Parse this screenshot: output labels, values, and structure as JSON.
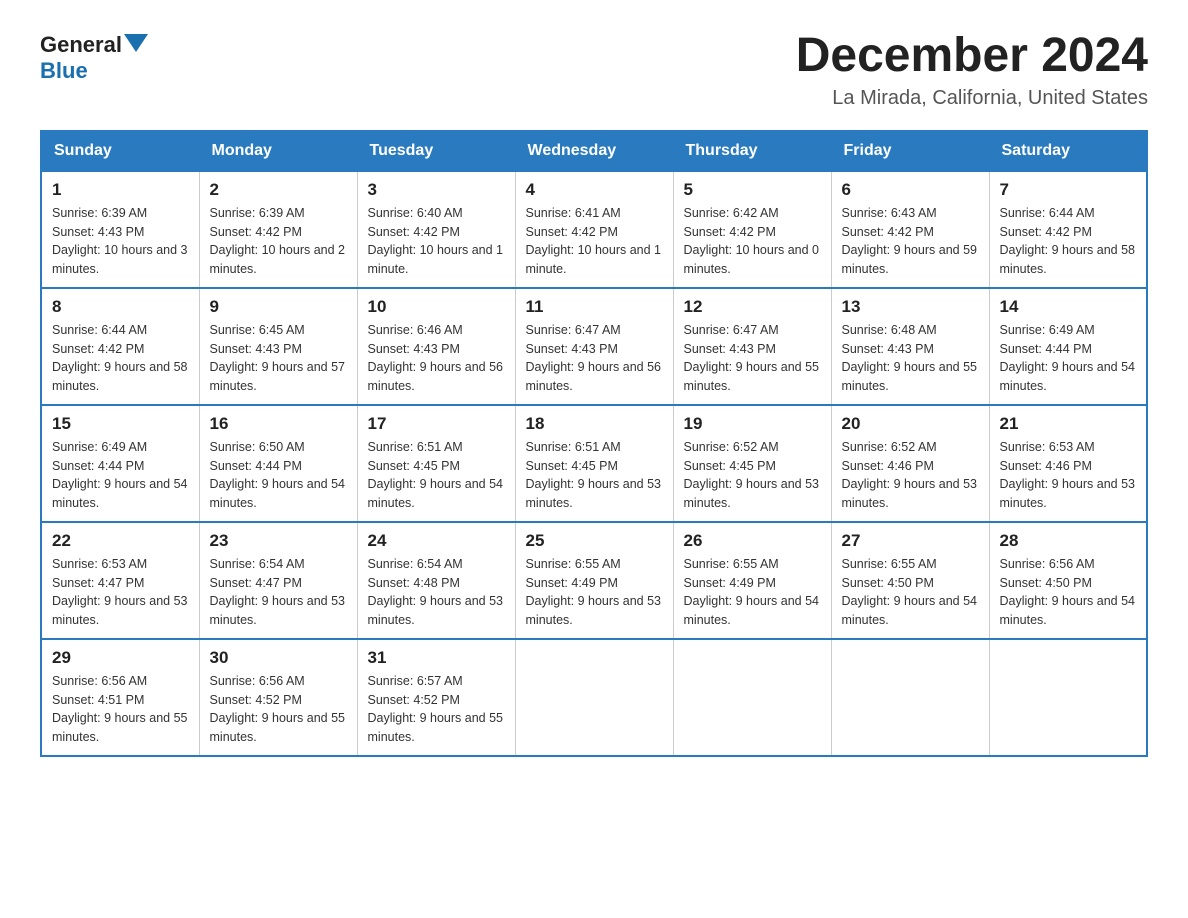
{
  "logo": {
    "general": "General",
    "blue": "Blue"
  },
  "header": {
    "month": "December 2024",
    "location": "La Mirada, California, United States"
  },
  "days_of_week": [
    "Sunday",
    "Monday",
    "Tuesday",
    "Wednesday",
    "Thursday",
    "Friday",
    "Saturday"
  ],
  "weeks": [
    [
      {
        "day": "1",
        "sunrise": "6:39 AM",
        "sunset": "4:43 PM",
        "daylight": "10 hours and 3 minutes."
      },
      {
        "day": "2",
        "sunrise": "6:39 AM",
        "sunset": "4:42 PM",
        "daylight": "10 hours and 2 minutes."
      },
      {
        "day": "3",
        "sunrise": "6:40 AM",
        "sunset": "4:42 PM",
        "daylight": "10 hours and 1 minute."
      },
      {
        "day": "4",
        "sunrise": "6:41 AM",
        "sunset": "4:42 PM",
        "daylight": "10 hours and 1 minute."
      },
      {
        "day": "5",
        "sunrise": "6:42 AM",
        "sunset": "4:42 PM",
        "daylight": "10 hours and 0 minutes."
      },
      {
        "day": "6",
        "sunrise": "6:43 AM",
        "sunset": "4:42 PM",
        "daylight": "9 hours and 59 minutes."
      },
      {
        "day": "7",
        "sunrise": "6:44 AM",
        "sunset": "4:42 PM",
        "daylight": "9 hours and 58 minutes."
      }
    ],
    [
      {
        "day": "8",
        "sunrise": "6:44 AM",
        "sunset": "4:42 PM",
        "daylight": "9 hours and 58 minutes."
      },
      {
        "day": "9",
        "sunrise": "6:45 AM",
        "sunset": "4:43 PM",
        "daylight": "9 hours and 57 minutes."
      },
      {
        "day": "10",
        "sunrise": "6:46 AM",
        "sunset": "4:43 PM",
        "daylight": "9 hours and 56 minutes."
      },
      {
        "day": "11",
        "sunrise": "6:47 AM",
        "sunset": "4:43 PM",
        "daylight": "9 hours and 56 minutes."
      },
      {
        "day": "12",
        "sunrise": "6:47 AM",
        "sunset": "4:43 PM",
        "daylight": "9 hours and 55 minutes."
      },
      {
        "day": "13",
        "sunrise": "6:48 AM",
        "sunset": "4:43 PM",
        "daylight": "9 hours and 55 minutes."
      },
      {
        "day": "14",
        "sunrise": "6:49 AM",
        "sunset": "4:44 PM",
        "daylight": "9 hours and 54 minutes."
      }
    ],
    [
      {
        "day": "15",
        "sunrise": "6:49 AM",
        "sunset": "4:44 PM",
        "daylight": "9 hours and 54 minutes."
      },
      {
        "day": "16",
        "sunrise": "6:50 AM",
        "sunset": "4:44 PM",
        "daylight": "9 hours and 54 minutes."
      },
      {
        "day": "17",
        "sunrise": "6:51 AM",
        "sunset": "4:45 PM",
        "daylight": "9 hours and 54 minutes."
      },
      {
        "day": "18",
        "sunrise": "6:51 AM",
        "sunset": "4:45 PM",
        "daylight": "9 hours and 53 minutes."
      },
      {
        "day": "19",
        "sunrise": "6:52 AM",
        "sunset": "4:45 PM",
        "daylight": "9 hours and 53 minutes."
      },
      {
        "day": "20",
        "sunrise": "6:52 AM",
        "sunset": "4:46 PM",
        "daylight": "9 hours and 53 minutes."
      },
      {
        "day": "21",
        "sunrise": "6:53 AM",
        "sunset": "4:46 PM",
        "daylight": "9 hours and 53 minutes."
      }
    ],
    [
      {
        "day": "22",
        "sunrise": "6:53 AM",
        "sunset": "4:47 PM",
        "daylight": "9 hours and 53 minutes."
      },
      {
        "day": "23",
        "sunrise": "6:54 AM",
        "sunset": "4:47 PM",
        "daylight": "9 hours and 53 minutes."
      },
      {
        "day": "24",
        "sunrise": "6:54 AM",
        "sunset": "4:48 PM",
        "daylight": "9 hours and 53 minutes."
      },
      {
        "day": "25",
        "sunrise": "6:55 AM",
        "sunset": "4:49 PM",
        "daylight": "9 hours and 53 minutes."
      },
      {
        "day": "26",
        "sunrise": "6:55 AM",
        "sunset": "4:49 PM",
        "daylight": "9 hours and 54 minutes."
      },
      {
        "day": "27",
        "sunrise": "6:55 AM",
        "sunset": "4:50 PM",
        "daylight": "9 hours and 54 minutes."
      },
      {
        "day": "28",
        "sunrise": "6:56 AM",
        "sunset": "4:50 PM",
        "daylight": "9 hours and 54 minutes."
      }
    ],
    [
      {
        "day": "29",
        "sunrise": "6:56 AM",
        "sunset": "4:51 PM",
        "daylight": "9 hours and 55 minutes."
      },
      {
        "day": "30",
        "sunrise": "6:56 AM",
        "sunset": "4:52 PM",
        "daylight": "9 hours and 55 minutes."
      },
      {
        "day": "31",
        "sunrise": "6:57 AM",
        "sunset": "4:52 PM",
        "daylight": "9 hours and 55 minutes."
      },
      null,
      null,
      null,
      null
    ]
  ]
}
